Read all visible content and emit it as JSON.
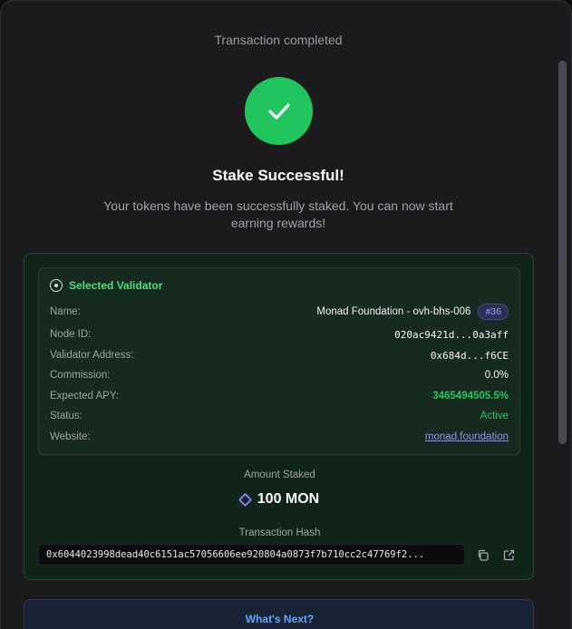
{
  "header": {
    "status_text": "Transaction completed"
  },
  "hero": {
    "title": "Stake Successful!",
    "subtitle": "Your tokens have been successfully staked. You can now start earning rewards!"
  },
  "validator": {
    "section_title": "Selected Validator",
    "rows": {
      "name": {
        "label": "Name:",
        "value": "Monad Foundation - ovh-bhs-006",
        "badge": "#36"
      },
      "node_id": {
        "label": "Node ID:",
        "value": "020ac9421d...0a3aff"
      },
      "address": {
        "label": "Validator Address:",
        "value": "0x684d...f6CE"
      },
      "commission": {
        "label": "Commission:",
        "value": "0.0%"
      },
      "apy": {
        "label": "Expected APY:",
        "value": "3465494505.5%"
      },
      "status": {
        "label": "Status:",
        "value": "Active"
      },
      "website": {
        "label": "Website:",
        "value": "monad.foundation"
      }
    }
  },
  "stake": {
    "amount_label": "Amount Staked",
    "amount": "100 MON",
    "hash_label": "Transaction Hash",
    "hash": "0x6044023998dead40c6151ac57056606ee920804a0873f7b710cc2c47769f2..."
  },
  "next": {
    "title": "What's Next?"
  },
  "colors": {
    "success": "#21c55d",
    "accent": "#8b8ff7",
    "info": "#60a5fa"
  },
  "icons": [
    "check-icon",
    "target-icon",
    "mon-token-icon",
    "copy-icon",
    "external-link-icon"
  ]
}
